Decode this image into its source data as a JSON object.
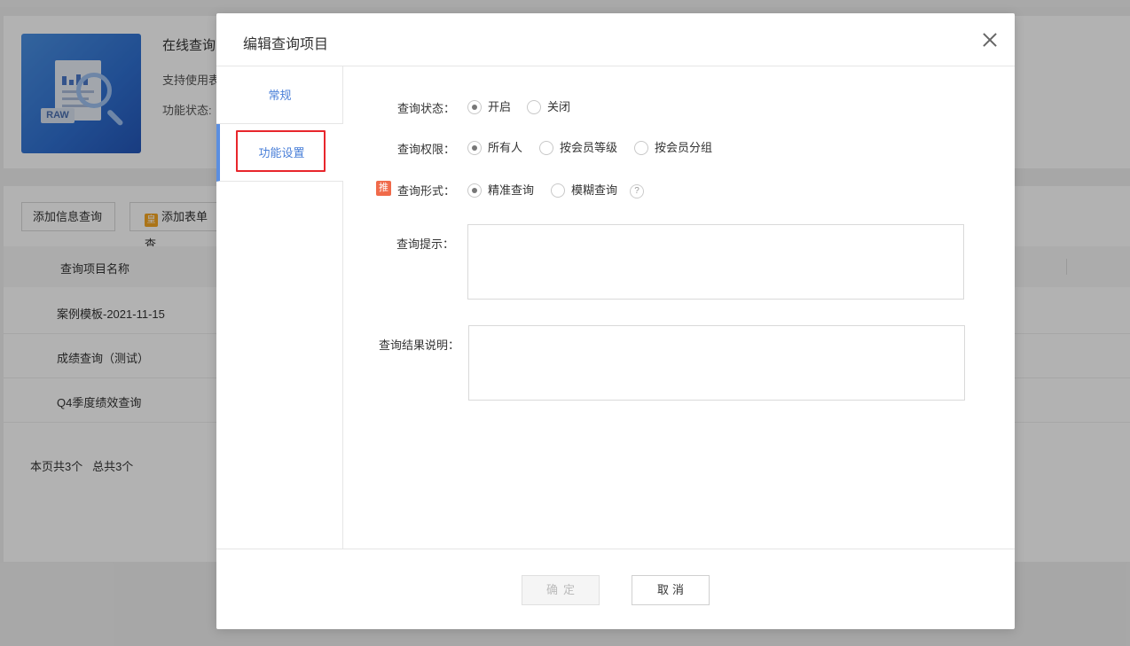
{
  "background": {
    "app": {
      "title": "在线查询",
      "description": "支持使用表",
      "status_label": "功能状态:",
      "thumb_label": "RAW"
    },
    "buttons": {
      "add_info_query": "添加信息查询",
      "add_form_query": "添加表单查",
      "crown_glyph": "皇"
    },
    "table": {
      "header_name": "查询项目名称",
      "rows": [
        "案例模板-2021-11-15",
        "成绩查询（测试）",
        "Q4季度绩效查询"
      ]
    },
    "pager": {
      "page_count": "本页共3个",
      "total_count": "总共3个"
    }
  },
  "modal": {
    "title": "编辑查询项目",
    "tabs": {
      "general": "常规",
      "function": "功能设置"
    },
    "form": {
      "status": {
        "label": "查询状态：",
        "options": [
          "开启",
          "关闭"
        ],
        "selected": "开启"
      },
      "permission": {
        "label": "查询权限：",
        "options": [
          "所有人",
          "按会员等级",
          "按会员分组"
        ],
        "selected": "所有人"
      },
      "mode": {
        "recommend_glyph": "推",
        "label": "查询形式：",
        "options": [
          "精准查询",
          "模糊查询"
        ],
        "selected": "精准查询",
        "help_glyph": "?"
      },
      "hint": {
        "label": "查询提示：",
        "value": ""
      },
      "result_desc": {
        "label": "查询结果说明：",
        "value": ""
      }
    },
    "footer": {
      "confirm": "确定",
      "cancel": "取消"
    }
  },
  "colors": {
    "accent": "#4a7fd8",
    "tab_indicator": "#5b8ee0",
    "highlight_box": "#e8262c",
    "recommend_badge": "#f06a4a",
    "crown_badge": "#f5a623"
  }
}
